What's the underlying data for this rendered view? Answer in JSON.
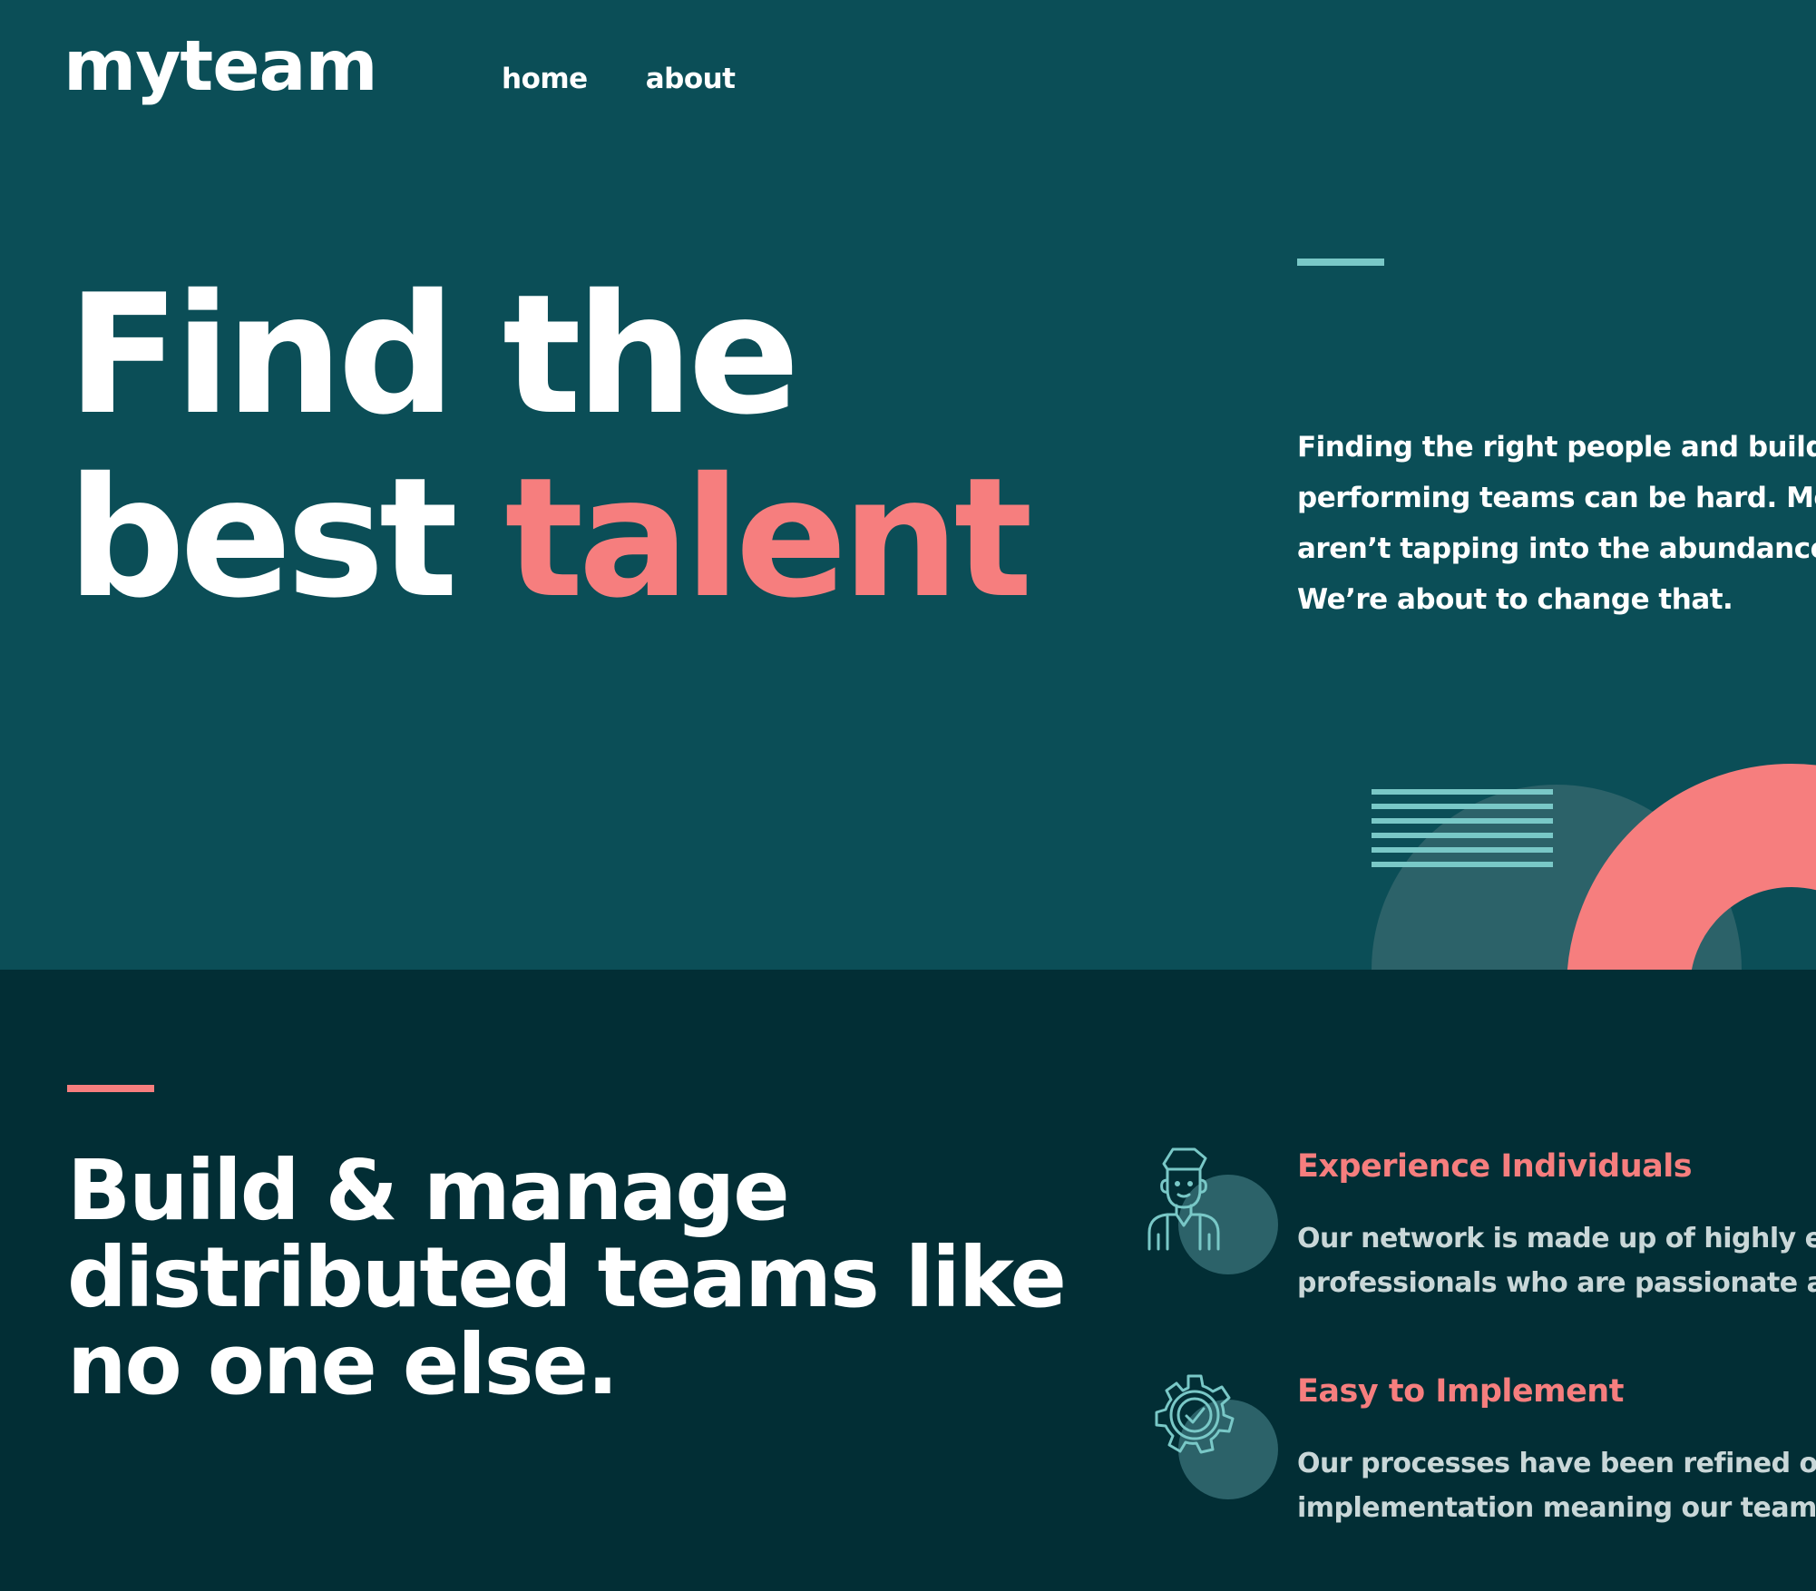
{
  "brand": {
    "logo": "myteam"
  },
  "nav": {
    "items": [
      "home",
      "about"
    ]
  },
  "hero": {
    "title_line1": "Find the",
    "title_line2_plain": "best ",
    "title_line2_accent": "talent",
    "description_lines": [
      "Finding the right people and buildi",
      "performing teams can be hard. Mo",
      "aren’t tapping into the abundance",
      "We’re about to change that."
    ]
  },
  "features_section": {
    "title": "Build & manage distributed teams like no one else.",
    "items": [
      {
        "icon": "person-icon",
        "title": "Experience Individuals",
        "lines": [
          "Our network is made up of highly expe",
          "professionals who are passionate abou"
        ]
      },
      {
        "icon": "cog-check-icon",
        "title": "Easy to Implement",
        "lines": [
          "Our processes have been refined over y",
          "implementation meaning our teams a"
        ]
      }
    ]
  },
  "colors": {
    "hero_bg": "#0b4e57",
    "features_bg": "#022e35",
    "accent_coral": "#f67e7e",
    "accent_teal": "#79c8c7",
    "white": "#ffffff"
  }
}
